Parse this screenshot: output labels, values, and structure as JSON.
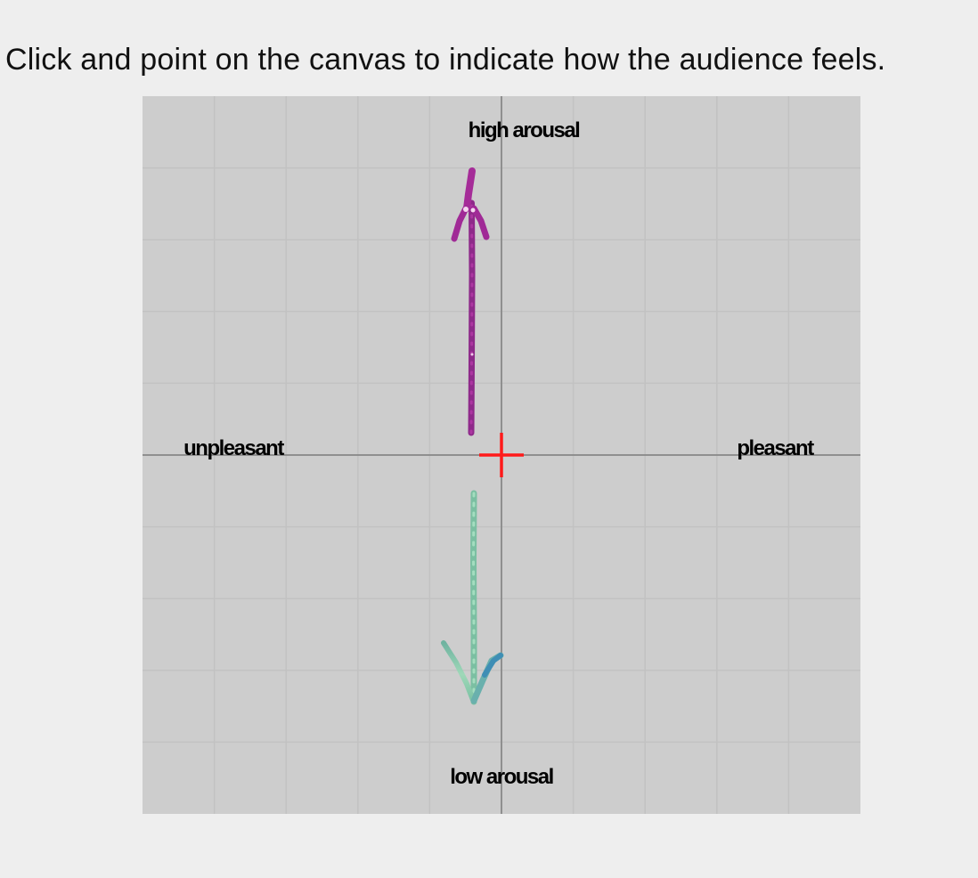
{
  "instruction": "Click and point on the canvas to indicate how the audience feels.",
  "canvas": {
    "labels": {
      "top": "high arousal",
      "bottom": "low arousal",
      "left": "unpleasant",
      "right": "pleasant"
    },
    "colors": {
      "background": "#cdcdcd",
      "grid": "#bdbdbd",
      "axis": "#8c8c8c",
      "cursor": "#ff1a1a",
      "high_arrow": "#a02a96",
      "low_arrow": "#7fc8a9",
      "low_arrow_accent": "#4a9ab8"
    },
    "cursor_icon": "crosshair-marker-icon",
    "strokes": [
      {
        "name": "high-arousal-arrow-icon",
        "direction": "up"
      },
      {
        "name": "low-arousal-arrow-icon",
        "direction": "down"
      }
    ]
  }
}
